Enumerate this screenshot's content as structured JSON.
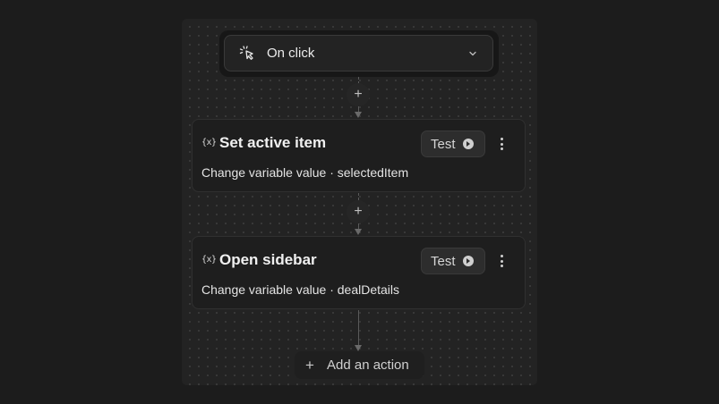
{
  "trigger": {
    "label": "On click",
    "icon": "click-cursor-icon",
    "dropdown_icon": "chevron-down-icon"
  },
  "actions": [
    {
      "icon_text": "{x}",
      "title": "Set active item",
      "subtitle": "Change variable value · selectedItem",
      "test_label": "Test"
    },
    {
      "icon_text": "{x}",
      "title": "Open sidebar",
      "subtitle": "Change variable value · dealDetails",
      "test_label": "Test"
    }
  ],
  "connectors": {
    "plus_symbol": "+"
  },
  "add_action": {
    "plus_symbol": "+",
    "label": "Add an action"
  },
  "colors": {
    "background": "#1c1c1c",
    "canvas": "#232323",
    "card": "#1e1e1e",
    "text": "#ececec"
  }
}
